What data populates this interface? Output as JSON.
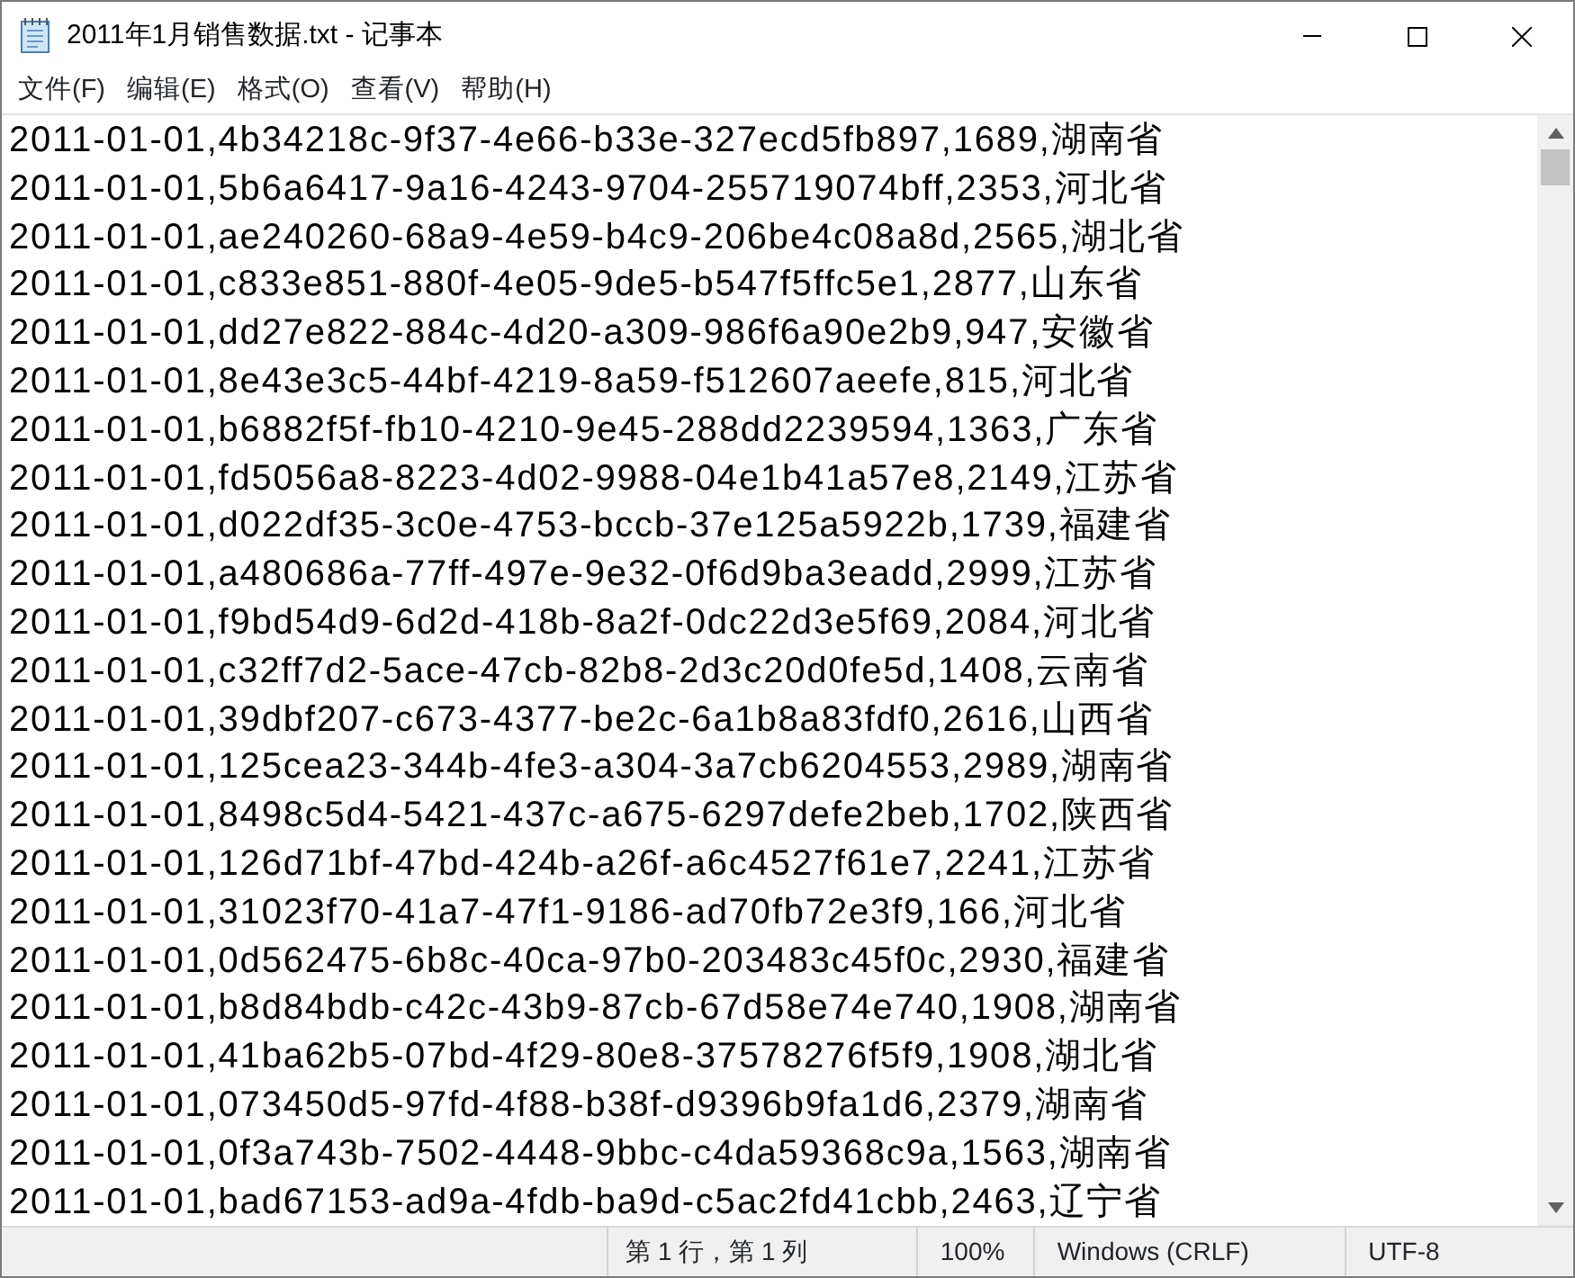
{
  "window": {
    "title": "2011年1月销售数据.txt - 记事本"
  },
  "menu": [
    "文件(F)",
    "编辑(E)",
    "格式(O)",
    "查看(V)",
    "帮助(H)"
  ],
  "lines": [
    "2011-01-01,4b34218c-9f37-4e66-b33e-327ecd5fb897,1689,湖南省",
    "2011-01-01,5b6a6417-9a16-4243-9704-255719074bff,2353,河北省",
    "2011-01-01,ae240260-68a9-4e59-b4c9-206be4c08a8d,2565,湖北省",
    "2011-01-01,c833e851-880f-4e05-9de5-b547f5ffc5e1,2877,山东省",
    "2011-01-01,dd27e822-884c-4d20-a309-986f6a90e2b9,947,安徽省",
    "2011-01-01,8e43e3c5-44bf-4219-8a59-f512607aeefe,815,河北省",
    "2011-01-01,b6882f5f-fb10-4210-9e45-288dd2239594,1363,广东省",
    "2011-01-01,fd5056a8-8223-4d02-9988-04e1b41a57e8,2149,江苏省",
    "2011-01-01,d022df35-3c0e-4753-bccb-37e125a5922b,1739,福建省",
    "2011-01-01,a480686a-77ff-497e-9e32-0f6d9ba3eadd,2999,江苏省",
    "2011-01-01,f9bd54d9-6d2d-418b-8a2f-0dc22d3e5f69,2084,河北省",
    "2011-01-01,c32ff7d2-5ace-47cb-82b8-2d3c20d0fe5d,1408,云南省",
    "2011-01-01,39dbf207-c673-4377-be2c-6a1b8a83fdf0,2616,山西省",
    "2011-01-01,125cea23-344b-4fe3-a304-3a7cb6204553,2989,湖南省",
    "2011-01-01,8498c5d4-5421-437c-a675-6297defe2beb,1702,陕西省",
    "2011-01-01,126d71bf-47bd-424b-a26f-a6c4527f61e7,2241,江苏省",
    "2011-01-01,31023f70-41a7-47f1-9186-ad70fb72e3f9,166,河北省",
    "2011-01-01,0d562475-6b8c-40ca-97b0-203483c45f0c,2930,福建省",
    "2011-01-01,b8d84bdb-c42c-43b9-87cb-67d58e74e740,1908,湖南省",
    "2011-01-01,41ba62b5-07bd-4f29-80e8-37578276f5f9,1908,湖北省",
    "2011-01-01,073450d5-97fd-4f88-b38f-d9396b9fa1d6,2379,湖南省",
    "2011-01-01,0f3a743b-7502-4448-9bbc-c4da59368c9a,1563,湖南省",
    "2011-01-01,bad67153-ad9a-4fdb-ba9d-c5ac2fd41cbb,2463,辽宁省"
  ],
  "status_bar": [
    "第 1 行，第 1 列",
    "100%",
    "Windows (CRLF)",
    "UTF-8"
  ]
}
